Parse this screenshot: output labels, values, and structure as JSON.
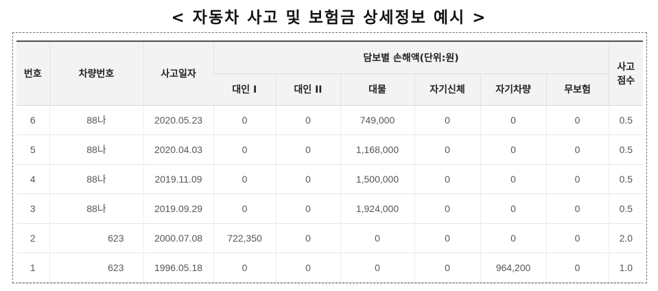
{
  "title": "< 자동차 사고 및 보험금 상세정보 예시 >",
  "table": {
    "headers": {
      "no": "번호",
      "car_no": "차량번호",
      "date": "사고일자",
      "loss_group": "담보별 손해액(단위:원)",
      "score_line1": "사고",
      "score_line2": "점수",
      "sub": [
        "대인 I",
        "대인 II",
        "대물",
        "자기신체",
        "자기차량",
        "무보험"
      ]
    },
    "rows": [
      {
        "no": "6",
        "car": "88나",
        "date": "2020.05.23",
        "c1": "0",
        "c2": "0",
        "c3": "749,000",
        "c4": "0",
        "c5": "0",
        "c6": "0",
        "score": "0.5"
      },
      {
        "no": "5",
        "car": "88나",
        "date": "2020.04.03",
        "c1": "0",
        "c2": "0",
        "c3": "1,168,000",
        "c4": "0",
        "c5": "0",
        "c6": "0",
        "score": "0.5"
      },
      {
        "no": "4",
        "car": "88나",
        "date": "2019.11.09",
        "c1": "0",
        "c2": "0",
        "c3": "1,500,000",
        "c4": "0",
        "c5": "0",
        "c6": "0",
        "score": "0.5"
      },
      {
        "no": "3",
        "car": "88나",
        "date": "2019.09.29",
        "c1": "0",
        "c2": "0",
        "c3": "1,924,000",
        "c4": "0",
        "c5": "0",
        "c6": "0",
        "score": "0.5"
      },
      {
        "no": "2",
        "car": "623",
        "date": "2000.07.08",
        "c1": "722,350",
        "c2": "0",
        "c3": "0",
        "c4": "0",
        "c5": "0",
        "c6": "0",
        "score": "2.0"
      },
      {
        "no": "1",
        "car": "623",
        "date": "1996.05.18",
        "c1": "0",
        "c2": "0",
        "c3": "0",
        "c4": "0",
        "c5": "964,200",
        "c6": "0",
        "score": "1.0"
      }
    ]
  }
}
